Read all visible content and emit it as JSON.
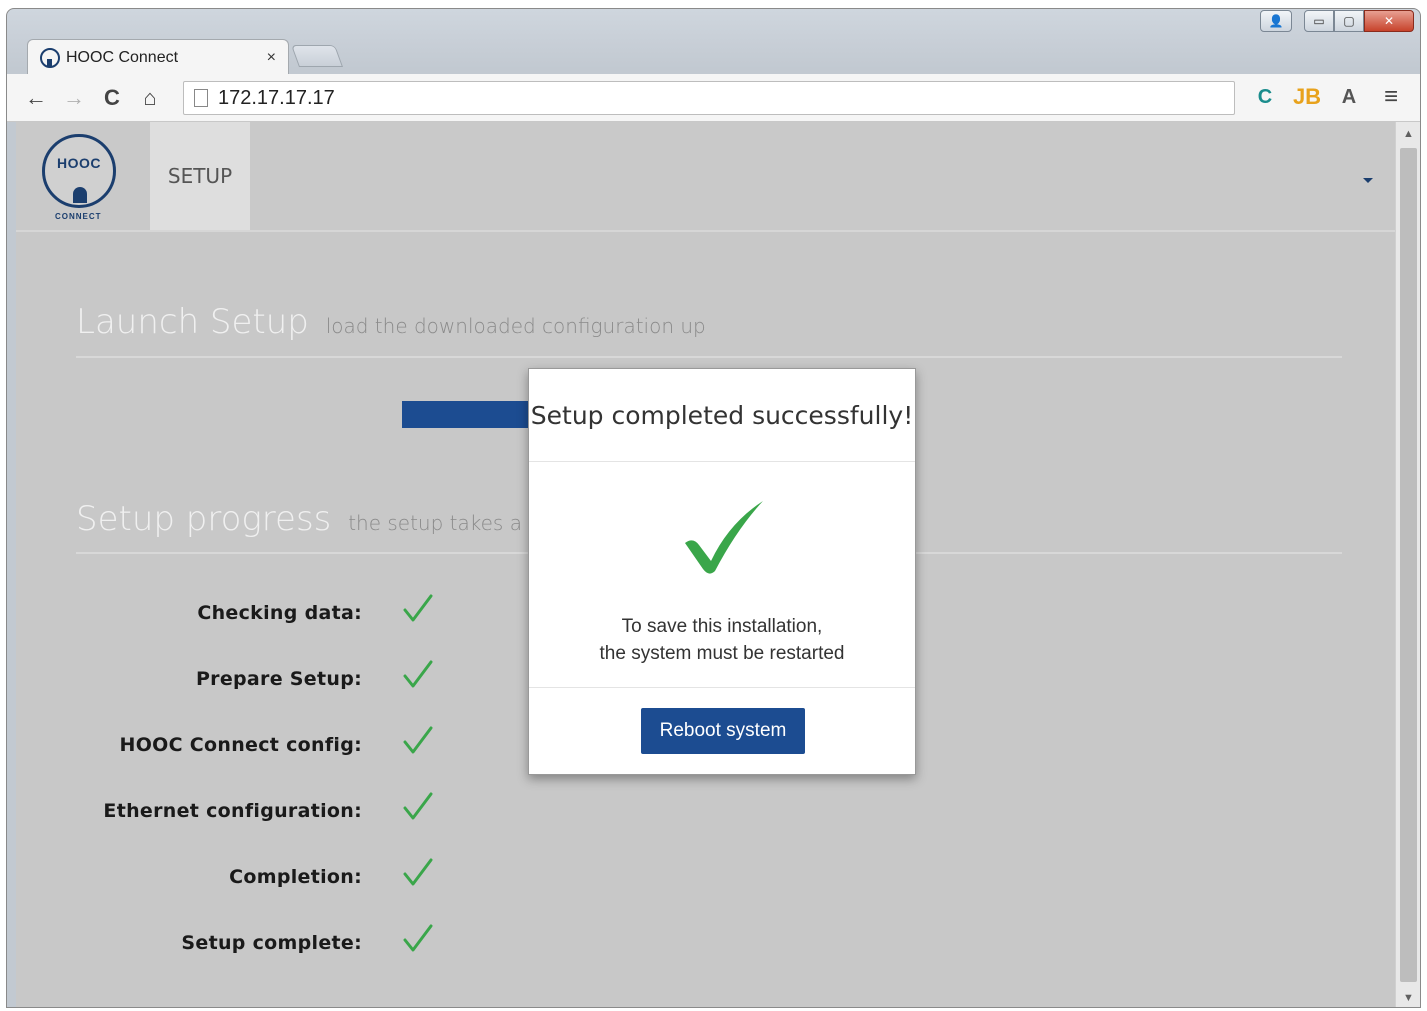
{
  "browser": {
    "tab_title": "HOOC Connect",
    "tab_close": "×",
    "url": "172.17.17.17",
    "nav": {
      "back": "←",
      "forward": "→",
      "reload": "C",
      "home": "⌂"
    },
    "window_controls": {
      "user": "👤",
      "minimize": "▭",
      "maximize": "▢",
      "close": "✕"
    },
    "extensions": [
      {
        "name": "curl-ext-icon",
        "glyph": "C"
      },
      {
        "name": "jb-ext-icon",
        "glyph": "JB"
      },
      {
        "name": "angular-ext-icon",
        "glyph": "A"
      }
    ],
    "menu_glyph": "≡"
  },
  "app": {
    "logo_word": "HOOC",
    "logo_sub": "CONNECT",
    "nav_item": "SETUP"
  },
  "launch": {
    "title": "Launch Setup",
    "subtitle": "load the downloaded configuration up",
    "progress_value": 100
  },
  "progress": {
    "title": "Setup progress",
    "subtitle": "the setup takes a few",
    "steps": [
      {
        "label": "Checking data:",
        "done": true
      },
      {
        "label": "Prepare Setup:",
        "done": true
      },
      {
        "label": "HOOC Connect config:",
        "done": true
      },
      {
        "label": "Ethernet configuration:",
        "done": true
      },
      {
        "label": "Completion:",
        "done": true
      },
      {
        "label": "Setup complete:",
        "done": true
      }
    ]
  },
  "modal": {
    "title": "Setup completed successfully!",
    "message_line1": "To save this installation,",
    "message_line2": "the system must be restarted",
    "button": "Reboot system"
  },
  "colors": {
    "brand_blue": "#1c4c91",
    "check_green": "#3aa64a",
    "logo_blue": "#1b3e6e"
  }
}
